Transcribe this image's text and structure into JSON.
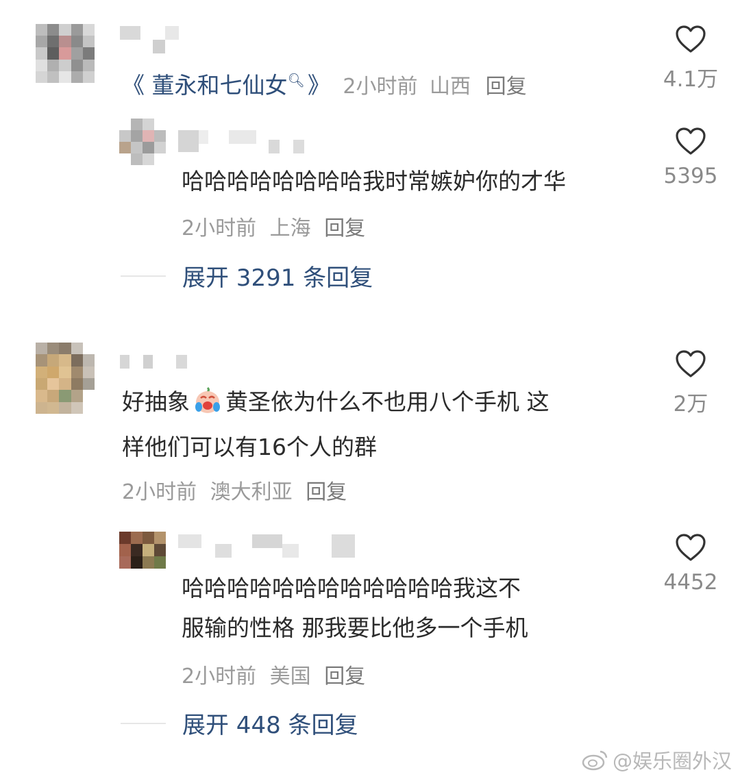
{
  "comments": [
    {
      "text_link": "《 董永和七仙女",
      "text_link_suffix": "》",
      "meta_time": "2小时前",
      "meta_loc": "山西",
      "reply_label": "回复",
      "likes": "4.1万",
      "reply": {
        "text": "哈哈哈哈哈哈哈哈我时常嫉妒你的才华",
        "meta_time": "2小时前",
        "meta_loc": "上海",
        "reply_label": "回复",
        "likes": "5395"
      },
      "expand_label": "展开 3291 条回复"
    },
    {
      "text_line1": "好抽象",
      "text_line1_after": "黄圣依为什么不也用八个手机 这",
      "text_line2": "样他们可以有16个人的群",
      "meta_time": "2小时前",
      "meta_loc": "澳大利亚",
      "reply_label": "回复",
      "likes": "2万",
      "reply": {
        "text_line1": "哈哈哈哈哈哈哈哈哈哈哈哈我这不",
        "text_line2": "服输的性格  那我要比他多一个手机",
        "meta_time": "2小时前",
        "meta_loc": "美国",
        "reply_label": "回复",
        "likes": "4452"
      },
      "expand_label": "展开 448 条回复"
    }
  ],
  "watermark": "@娱乐圈外汉",
  "icons": {
    "like": "heart-outline-icon",
    "emoji": "crying-laughing-emoji-icon",
    "search": "search-icon",
    "weibo": "weibo-logo-icon"
  },
  "colors": {
    "link": "#2f4f7a",
    "meta": "#9a9a9a",
    "text": "#2b2b2b"
  }
}
